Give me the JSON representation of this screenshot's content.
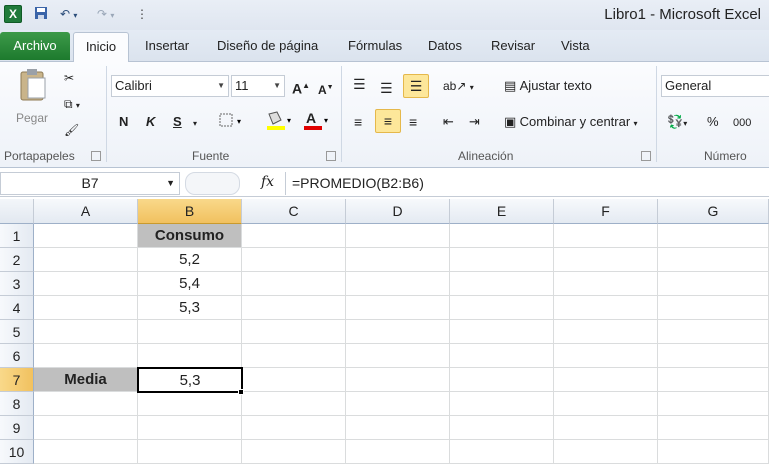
{
  "titlebar": {
    "app_icon": "X",
    "window_title": "Libro1  -  Microsoft Excel"
  },
  "tabs": {
    "file": "Archivo",
    "items": [
      "Inicio",
      "Insertar",
      "Diseño de página",
      "Fórmulas",
      "Datos",
      "Revisar",
      "Vista"
    ],
    "active": "Inicio"
  },
  "ribbon": {
    "clipboard": {
      "paste": "Pegar",
      "label": "Portapapeles"
    },
    "font": {
      "name": "Calibri",
      "size": "11",
      "bold": "N",
      "italic": "K",
      "underline": "S",
      "label": "Fuente",
      "highlight_color": "#ffff00",
      "font_color": "#e00000"
    },
    "alignment": {
      "wrap": "Ajustar texto",
      "merge": "Combinar y centrar",
      "label": "Alineación"
    },
    "number": {
      "format": "General",
      "percent": "%",
      "thousands": "000",
      "label": "Número"
    }
  },
  "formula_bar": {
    "name_box": "B7",
    "fx": "fx",
    "formula": "=PROMEDIO(B2:B6)"
  },
  "sheet": {
    "columns": [
      "A",
      "B",
      "C",
      "D",
      "E",
      "F",
      "G"
    ],
    "rows": [
      "1",
      "2",
      "3",
      "4",
      "5",
      "6",
      "7",
      "8",
      "9",
      "10"
    ],
    "cells": {
      "B1": "Consumo",
      "B2": "5,2",
      "B3": "5,4",
      "B4": "5,3",
      "A7": "Media",
      "B7": "5,3"
    },
    "active_cell": "B7",
    "header_fill_color": "#bfbfbf"
  }
}
